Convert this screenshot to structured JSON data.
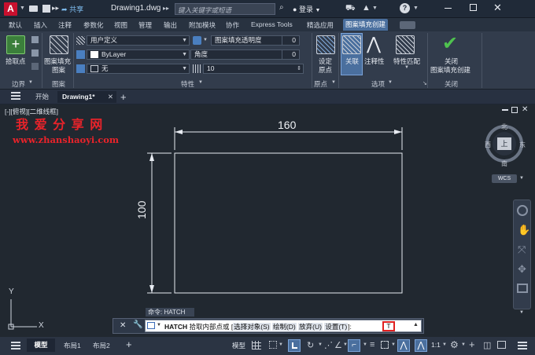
{
  "app": {
    "logo_letter": "A",
    "share_label": "共享",
    "doc_title": "Drawing1.dwg",
    "search_placeholder": "键入关键字或短语",
    "login_label": "登录",
    "help_icon": "?",
    "brand_color": "#c8102e"
  },
  "menu_tabs": [
    "默认",
    "插入",
    "注释",
    "参数化",
    "视图",
    "管理",
    "输出",
    "附加模块",
    "协作",
    "Express Tools",
    "精选应用",
    "图案填充创建"
  ],
  "active_menu_tab": "图案填充创建",
  "ribbon": {
    "pick_point": "拾取点",
    "boundary_group": "边界",
    "pattern_label_1": "图案填充",
    "pattern_label_2": "图案",
    "pattern_group": "图案",
    "type_value": "用户定义",
    "color_value": "ByLayer",
    "bgcolor_value": "无",
    "transparency_label": "图案填充透明度",
    "transparency_value": "0",
    "angle_label": "角度",
    "angle_value": "0",
    "spacing_value": "10",
    "properties_group": "特性",
    "set_origin_1": "设定",
    "set_origin_2": "原点",
    "origin_group": "原点",
    "associative": "关联",
    "annotative": "注释性",
    "match_props": "特性匹配",
    "options_group": "选项",
    "close_1": "关闭",
    "close_2": "图案填充创建",
    "close_group": "关闭"
  },
  "file_tabs": {
    "start": "开始",
    "drawing": "Drawing1*",
    "add": "+"
  },
  "viewport": {
    "label": "[-][俯视][二维线框]"
  },
  "watermark": {
    "title": "我 爱 分 享 网",
    "url": "www.zhanshaoyi.com",
    "color": "#e8232a"
  },
  "drawing": {
    "dim_width": "160",
    "dim_height": "100"
  },
  "viewcube": {
    "north": "北",
    "south": "南",
    "east": "东",
    "west": "西",
    "top": "上",
    "wcs": "WCS"
  },
  "ucs": {
    "y": "Y",
    "x": "X"
  },
  "command": {
    "history": "命令: HATCH",
    "name": "HATCH",
    "prompt": "拾取内部点或 [",
    "opt_select": "选择对象(S)",
    "opt_draw": "绘制(D)",
    "opt_undo": "放弃(U)",
    "opt_settings": "设置(T)",
    "tail": "]:",
    "input_value": "T"
  },
  "status": {
    "model": "模型",
    "layout1": "布局1",
    "layout2": "布局2",
    "add": "+",
    "model_btn": "模型",
    "scale": "1:1"
  }
}
